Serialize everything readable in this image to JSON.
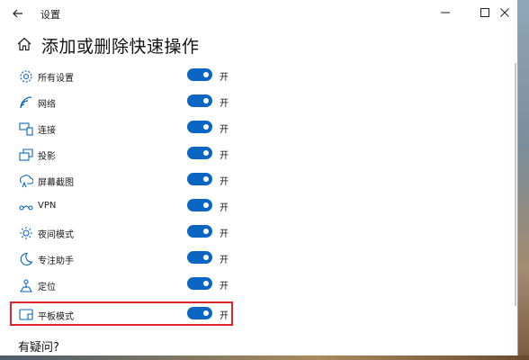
{
  "window": {
    "title": "设置"
  },
  "page": {
    "title": "添加或删除快速操作",
    "help_heading": "有疑问?"
  },
  "items": [
    {
      "label": "所有设置",
      "state": "开",
      "icon": "gear-icon",
      "on": true
    },
    {
      "label": "网络",
      "state": "开",
      "icon": "wifi-icon",
      "on": true
    },
    {
      "label": "连接",
      "state": "开",
      "icon": "connect-icon",
      "on": true
    },
    {
      "label": "投影",
      "state": "开",
      "icon": "project-icon",
      "on": true
    },
    {
      "label": "屏幕截图",
      "state": "开",
      "icon": "screenshot-icon",
      "on": true
    },
    {
      "label": "VPN",
      "state": "开",
      "icon": "vpn-icon",
      "on": true
    },
    {
      "label": "夜间模式",
      "state": "开",
      "icon": "brightness-icon",
      "on": true
    },
    {
      "label": "专注助手",
      "state": "开",
      "icon": "moon-icon",
      "on": true
    },
    {
      "label": "定位",
      "state": "开",
      "icon": "location-icon",
      "on": true
    },
    {
      "label": "平板模式",
      "state": "开",
      "icon": "tablet-icon",
      "on": true
    }
  ],
  "colors": {
    "accent": "#0a66c2",
    "highlight": "#e0262c"
  }
}
